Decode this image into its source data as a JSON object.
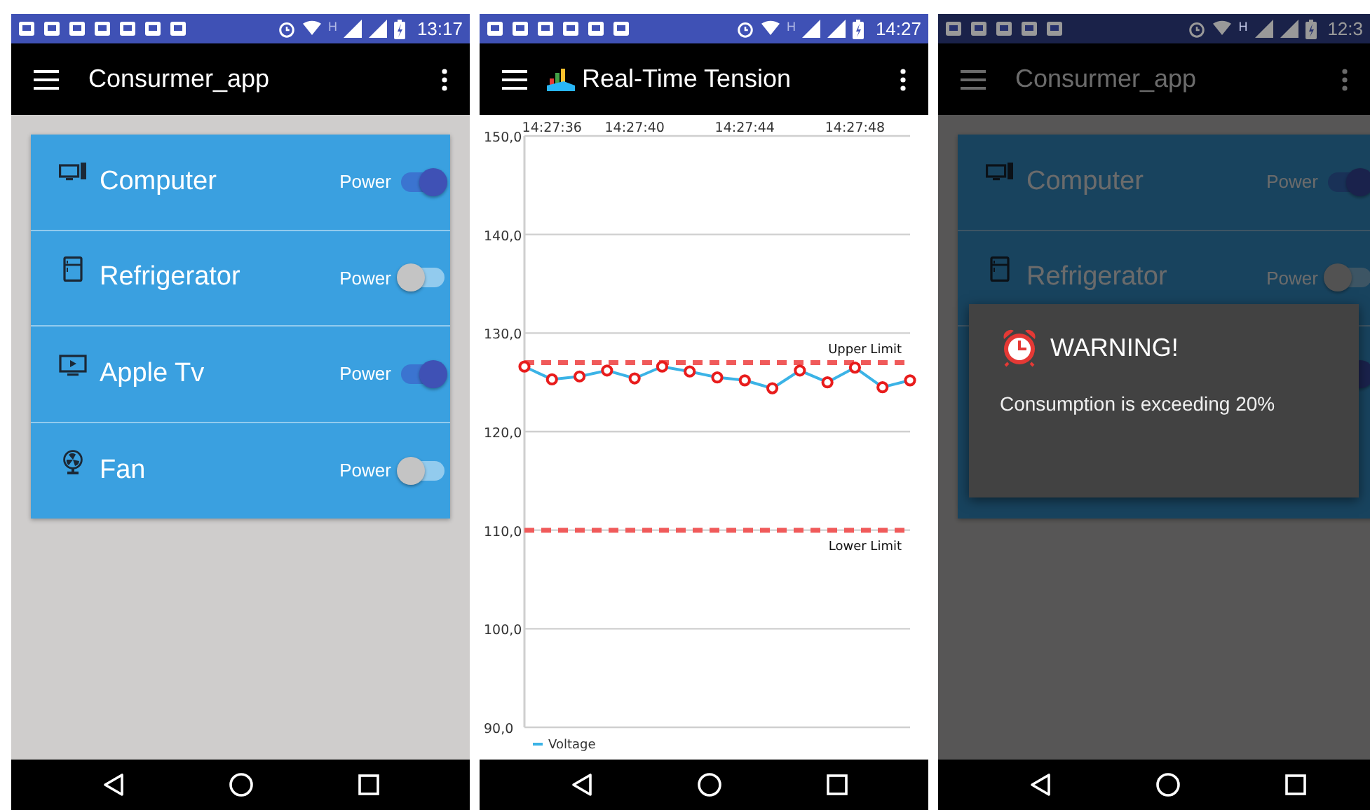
{
  "screens": [
    {
      "kind": "devices",
      "dimmed": false,
      "status_bar": {
        "network": "H",
        "time": "13:17"
      },
      "app_bar": {
        "title": "Consurmer_app"
      },
      "devices": [
        {
          "name": "Computer",
          "power_label": "Power",
          "on": true
        },
        {
          "name": "Refrigerator",
          "power_label": "Power",
          "on": false
        },
        {
          "name": "Apple Tv",
          "power_label": "Power",
          "on": true
        },
        {
          "name": "Fan",
          "power_label": "Power",
          "on": false
        }
      ]
    },
    {
      "kind": "chart",
      "dimmed": false,
      "status_bar": {
        "network": "H",
        "time": "14:27"
      },
      "app_bar": {
        "title": "Real-Time Tension"
      },
      "chart_data": {
        "type": "line",
        "categories": [
          null,
          "14:27:36",
          null,
          null,
          "14:27:40",
          null,
          null,
          null,
          "14:27:44",
          null,
          null,
          null,
          "14:27:48",
          null,
          null
        ],
        "ylim": [
          90,
          150
        ],
        "grid": true,
        "yticks": [
          {
            "value": 90,
            "label": "90,0"
          },
          {
            "value": 100,
            "label": "100,0"
          },
          {
            "value": 110,
            "label": "110,0"
          },
          {
            "value": 120,
            "label": "120,0"
          },
          {
            "value": 130,
            "label": "130,0"
          },
          {
            "value": 140,
            "label": "140,0"
          },
          {
            "value": 150,
            "label": "150,0"
          }
        ],
        "series": [
          {
            "name": "Voltage",
            "color": "#3bb3e6",
            "marker": "circle",
            "values": [
              126.6,
              125.3,
              125.6,
              126.2,
              125.4,
              126.6,
              126.1,
              125.5,
              125.2,
              124.4,
              126.2,
              125.0,
              126.5,
              124.5,
              125.2
            ]
          }
        ],
        "ref_lines": [
          {
            "axis": "y",
            "value": 127,
            "label": "Upper Limit"
          },
          {
            "axis": "y",
            "value": 110,
            "label": "Lower Limit"
          }
        ]
      }
    },
    {
      "kind": "devices",
      "dimmed": true,
      "status_bar": {
        "network": "H",
        "time": "12:3"
      },
      "app_bar": {
        "title": "Consurmer_app"
      },
      "devices": [
        {
          "name": "Computer",
          "power_label": "Power",
          "on": true
        },
        {
          "name": "Refrigerator",
          "power_label": "Power",
          "on": false
        },
        {
          "on": true
        }
      ],
      "dialog": {
        "title": "WARNING!",
        "message": "Consumption is exceeding 20%"
      }
    }
  ]
}
